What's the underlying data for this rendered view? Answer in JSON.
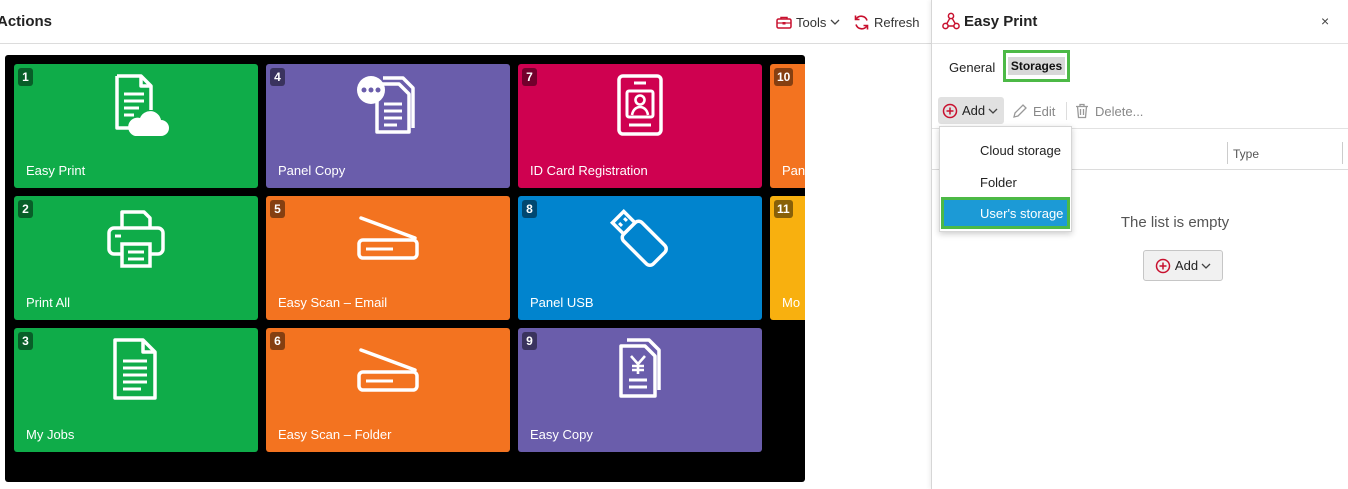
{
  "header": {
    "title": "Actions",
    "tools_label": "Tools",
    "refresh_label": "Refresh"
  },
  "tiles": [
    {
      "num": "1",
      "label": "Easy Print",
      "color": "#0fac49",
      "icon": "document-cloud-icon"
    },
    {
      "num": "4",
      "label": "Panel Copy",
      "color": "#6a5dab",
      "icon": "copy-documents-icon"
    },
    {
      "num": "7",
      "label": "ID Card Registration",
      "color": "#cf0150",
      "icon": "id-card-icon"
    },
    {
      "num": "10",
      "label": "Pan",
      "color": "#f37320",
      "icon": ""
    },
    {
      "num": "2",
      "label": "Print All",
      "color": "#0fac49",
      "icon": "printer-icon"
    },
    {
      "num": "5",
      "label": "Easy Scan – Email",
      "color": "#f37320",
      "icon": "scanner-icon"
    },
    {
      "num": "8",
      "label": "Panel USB",
      "color": "#0184ce",
      "icon": "usb-drive-icon"
    },
    {
      "num": "11",
      "label": "Mo",
      "color": "#f8b00f",
      "icon": ""
    },
    {
      "num": "3",
      "label": "My Jobs",
      "color": "#0fac49",
      "icon": "document-list-icon"
    },
    {
      "num": "6",
      "label": "Easy Scan – Folder",
      "color": "#f37320",
      "icon": "scanner-icon"
    },
    {
      "num": "9",
      "label": "Easy Copy",
      "color": "#6a5dab",
      "icon": "easy-copy-icon"
    }
  ],
  "panel": {
    "title": "Easy Print",
    "close": "×",
    "tabs": {
      "general": "General",
      "storages": "Storages"
    },
    "toolbar": {
      "add": "Add",
      "edit": "Edit",
      "delete": "Delete..."
    },
    "columns": {
      "type": "Type"
    },
    "empty_text": "The list is empty",
    "empty_add": "Add",
    "dropdown": [
      "Cloud storage",
      "Folder",
      "User's storage"
    ]
  },
  "colors": {
    "accent_red": "#c8102e",
    "highlight_green": "#4cb946",
    "selection_blue": "#1c9ad6"
  }
}
